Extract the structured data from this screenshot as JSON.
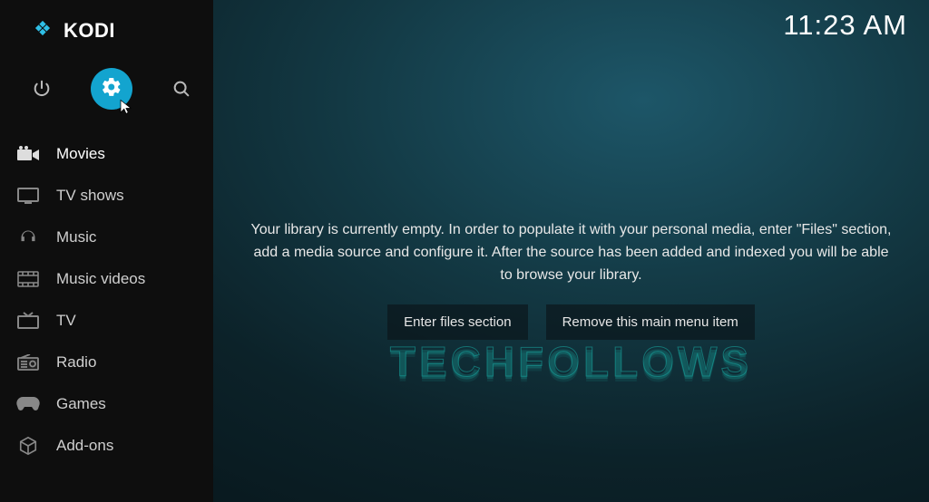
{
  "brand": "KODI",
  "clock": "11:23 AM",
  "sidebar": {
    "items": [
      {
        "label": "Movies"
      },
      {
        "label": "TV shows"
      },
      {
        "label": "Music"
      },
      {
        "label": "Music videos"
      },
      {
        "label": "TV"
      },
      {
        "label": "Radio"
      },
      {
        "label": "Games"
      },
      {
        "label": "Add-ons"
      }
    ]
  },
  "main": {
    "message": "Your library is currently empty. In order to populate it with your personal media, enter \"Files\" section, add a media source and configure it. After the source has been added and indexed you will be able to browse your library.",
    "buttons": {
      "enter_files": "Enter files section",
      "remove_item": "Remove this main menu item"
    }
  },
  "watermark": "TECHFOLLOWS"
}
